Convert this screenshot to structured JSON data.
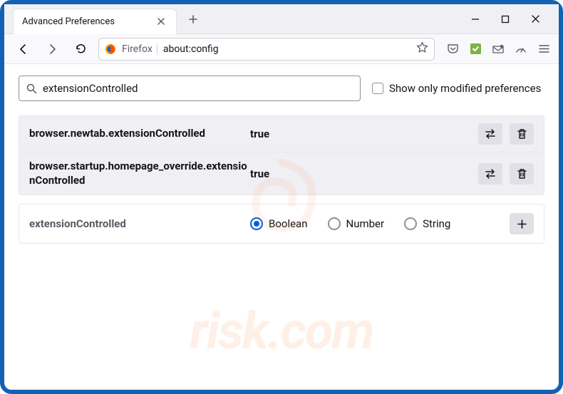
{
  "titlebar": {
    "tab_title": "Advanced Preferences"
  },
  "toolbar": {
    "identity_label": "Firefox",
    "url_text": "about:config"
  },
  "search": {
    "value": "extensionControlled",
    "checkbox_label": "Show only modified preferences"
  },
  "prefs": [
    {
      "name": "browser.newtab.extensionControlled",
      "value": "true"
    },
    {
      "name": "browser.startup.homepage_override.extensionControlled",
      "value": "true"
    }
  ],
  "new_pref": {
    "name": "extensionControlled",
    "types": [
      "Boolean",
      "Number",
      "String"
    ],
    "selected": "Boolean"
  },
  "watermark": "risk.com"
}
